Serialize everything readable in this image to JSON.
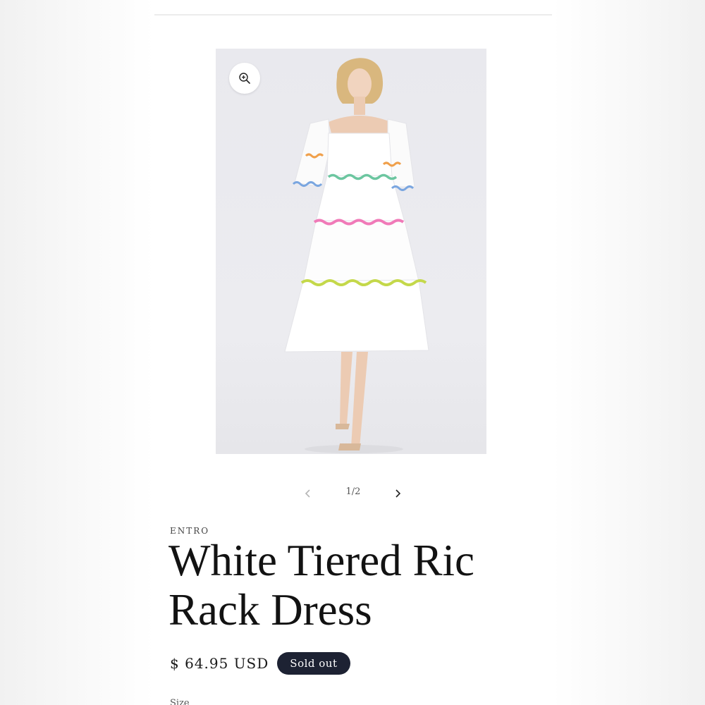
{
  "product": {
    "vendor": "ENTRO",
    "title": "White Tiered Ric Rack Dress",
    "price": "$ 64.95 USD",
    "status_badge": "Sold out",
    "size_label": "Size"
  },
  "gallery": {
    "counter": "1/2",
    "prev_icon": "chevron-left-icon",
    "next_icon": "chevron-right-icon",
    "zoom_icon": "zoom-in-icon"
  },
  "colors": {
    "badge_bg": "#1d2233",
    "trim_orange": "#f0a04b",
    "trim_green": "#6cc6a0",
    "trim_blue": "#7aa6e0",
    "trim_pink": "#f07ab8",
    "trim_lime": "#c4d84a"
  }
}
